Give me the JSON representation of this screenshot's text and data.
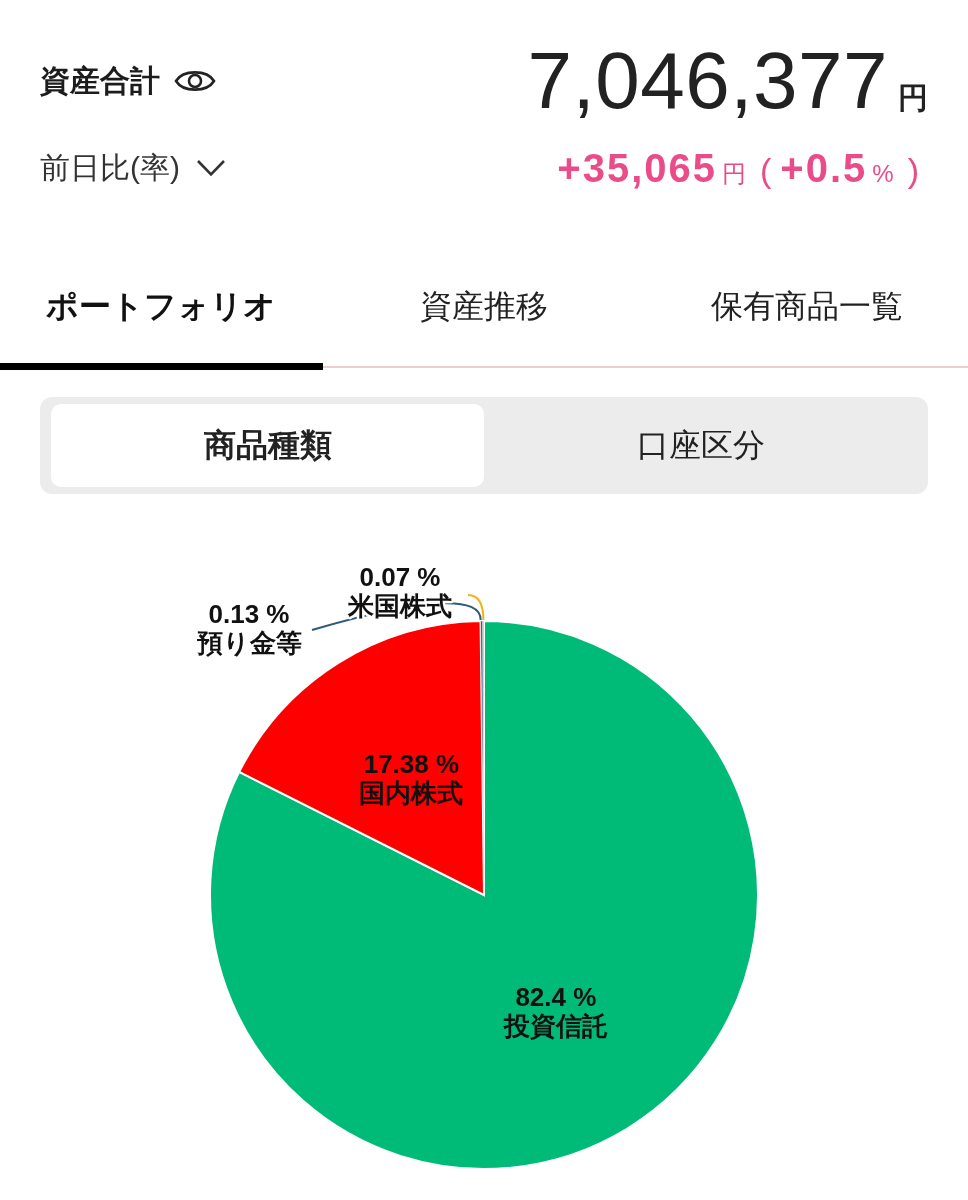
{
  "summary": {
    "label": "資産合計",
    "total": "7,046,377",
    "unit": "円",
    "change_label": "前日比(率)",
    "change": {
      "amount": "+35,065",
      "unit": "円",
      "open": "(",
      "rate": "+0.5",
      "percent": "%",
      "close": ")"
    }
  },
  "tabs": [
    {
      "label": "ポートフォリオ",
      "selected": true
    },
    {
      "label": "資産推移",
      "selected": false
    },
    {
      "label": "保有商品一覧",
      "selected": false
    }
  ],
  "segments": [
    {
      "label": "商品種類",
      "selected": true
    },
    {
      "label": "口座区分",
      "selected": false
    }
  ],
  "allocation": {
    "chart_data": {
      "type": "pie",
      "categories": [
        "投資信託",
        "国内株式",
        "預り金等",
        "米国株式"
      ],
      "values": [
        82.4,
        17.38,
        0.13,
        0.07
      ],
      "colors": [
        "#00bb78",
        "#ff0000",
        "#2e5a7c",
        "#f2b31a"
      ],
      "value_labels": [
        "82.4 %",
        "17.38 %",
        "0.13 %",
        "0.07 %"
      ]
    }
  }
}
